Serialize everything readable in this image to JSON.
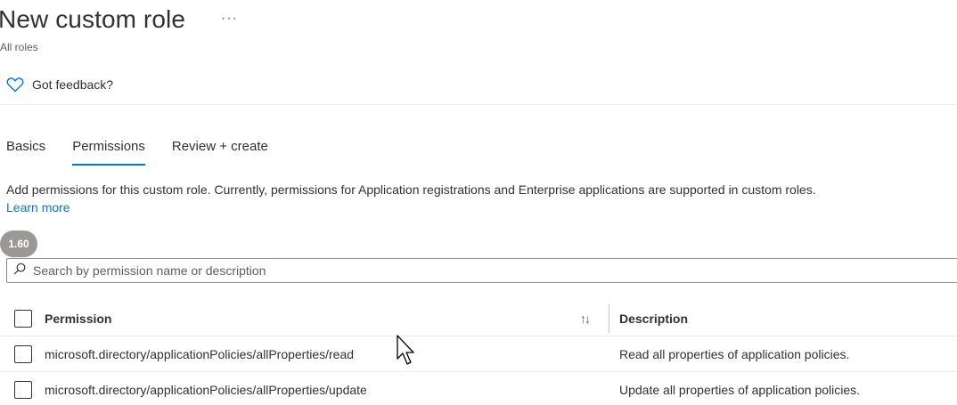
{
  "header": {
    "title": "New custom role",
    "more_label": "···",
    "breadcrumb": "All roles"
  },
  "feedback": {
    "icon": "heart-icon",
    "label": "Got feedback?"
  },
  "tabs": [
    {
      "label": "Basics",
      "active": false
    },
    {
      "label": "Permissions",
      "active": true
    },
    {
      "label": "Review + create",
      "active": false
    }
  ],
  "description": {
    "text": "Add permissions for this custom role. Currently, permissions for Application registrations and Enterprise applications are supported in custom roles. ",
    "link": "Learn more"
  },
  "badge": "1.60",
  "search": {
    "icon": "search-icon",
    "placeholder": "Search by permission name or description",
    "value": ""
  },
  "table": {
    "columns": {
      "permission": "Permission",
      "sort_icon": "↑↓",
      "description": "Description"
    },
    "rows": [
      {
        "permission": "microsoft.directory/applicationPolicies/allProperties/read",
        "description": "Read all properties of application policies."
      },
      {
        "permission": "microsoft.directory/applicationPolicies/allProperties/update",
        "description": "Update all properties of application policies."
      }
    ]
  },
  "colors": {
    "accent": "#0078d4",
    "text": "#323130",
    "muted": "#605e5c"
  }
}
